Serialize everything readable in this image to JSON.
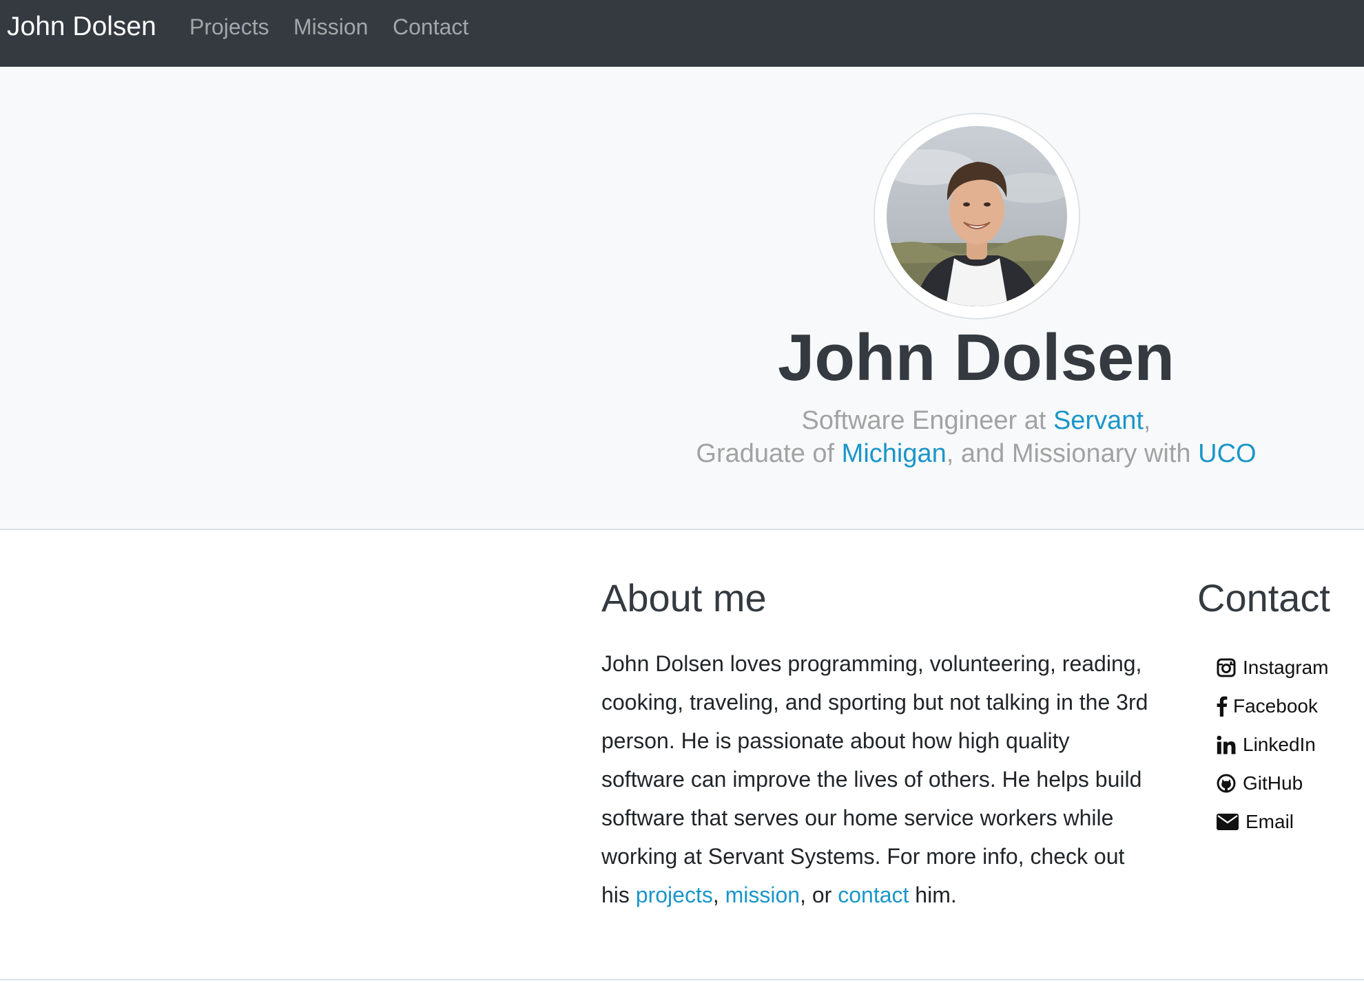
{
  "navbar": {
    "brand": "John Dolsen",
    "links": [
      "Projects",
      "Mission",
      "Contact"
    ]
  },
  "hero": {
    "avatar_alt": "profile-photo",
    "name": "John Dolsen",
    "line1": {
      "prefix": "Software Engineer at ",
      "link": "Servant",
      "suffix": ","
    },
    "line2": {
      "prefix": "Graduate of ",
      "link1": "Michigan",
      "middle": ", and Missionary with ",
      "link2": "UCO"
    }
  },
  "about": {
    "title": "About me",
    "text": "John Dolsen loves programming, volunteering, reading, cooking, traveling, and sporting but not talking in the 3rd person. He is passionate about how high quality software can improve the lives of others. He helps build software that serves our home service workers while working at Servant Systems. For more info, check out his ",
    "link_projects": "projects",
    "sep1": ", ",
    "link_mission": "mission",
    "sep2": ", or ",
    "link_contact": "contact",
    "end": " him."
  },
  "contact": {
    "title": "Contact",
    "items": [
      {
        "label": "Instagram",
        "icon": "instagram-icon"
      },
      {
        "label": "Facebook",
        "icon": "facebook-icon"
      },
      {
        "label": "LinkedIn",
        "icon": "linkedin-icon"
      },
      {
        "label": "GitHub",
        "icon": "github-icon"
      },
      {
        "label": "Email",
        "icon": "envelope-icon"
      }
    ]
  },
  "colors": {
    "navbar_bg": "#343a40",
    "hero_bg": "#f8f9fa",
    "link": "#1a96c9",
    "heading": "#343a40",
    "muted": "#a2a2a2"
  }
}
